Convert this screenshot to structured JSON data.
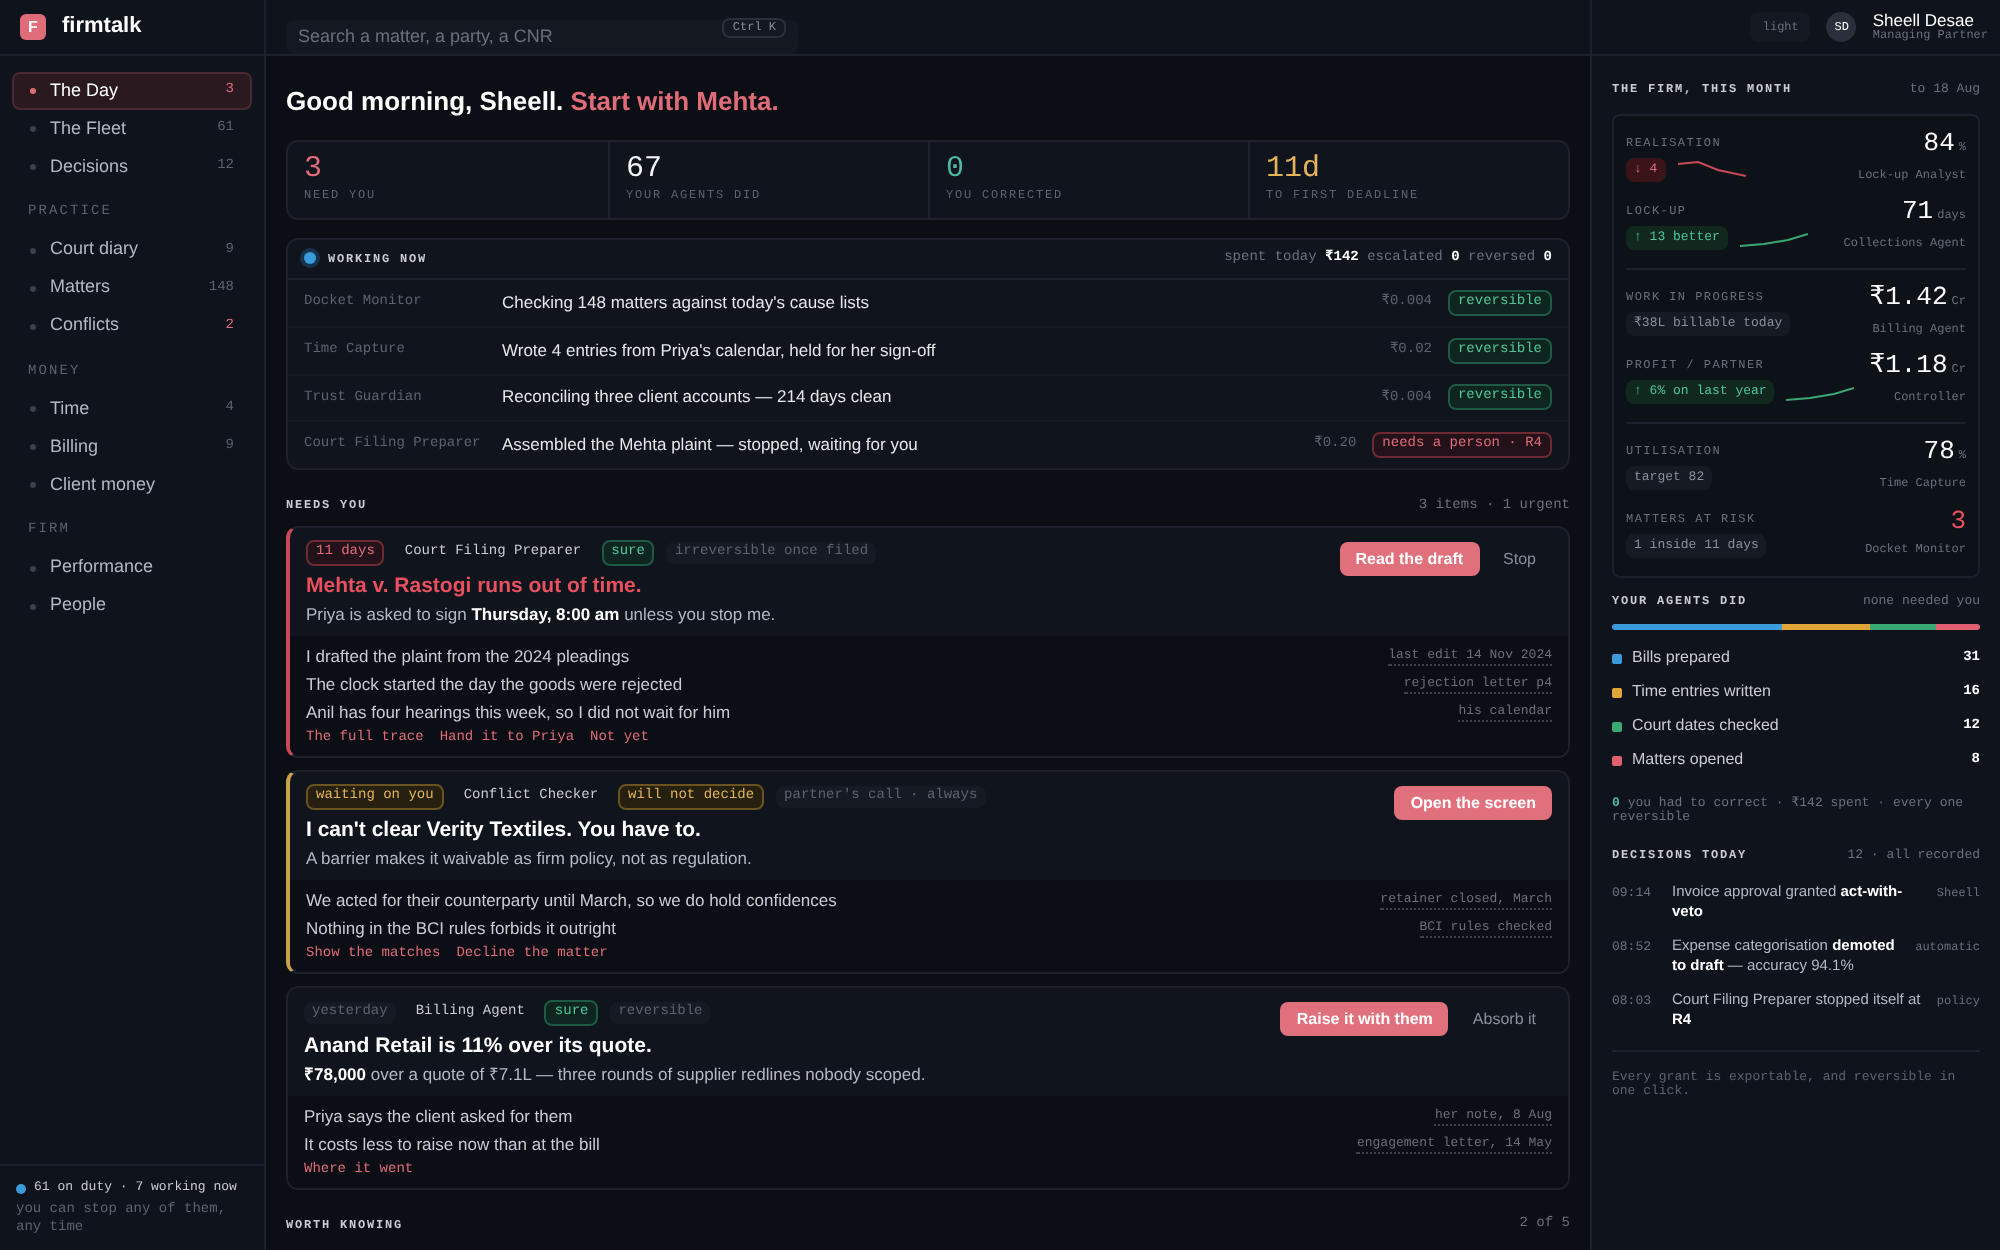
{
  "brand": {
    "letter": "F",
    "name": "firmtalk"
  },
  "sidebar": {
    "sections": [
      {
        "items": [
          {
            "label": "The Day",
            "count": "3",
            "selected": true,
            "alert": true
          },
          {
            "label": "The Fleet",
            "count": "61",
            "selected": false,
            "alert": false
          },
          {
            "label": "Decisions",
            "count": "12",
            "selected": false,
            "alert": false
          }
        ]
      },
      {
        "heading": "PRACTICE",
        "items": [
          {
            "label": "Court diary",
            "count": "9",
            "selected": false,
            "alert": false
          },
          {
            "label": "Matters",
            "count": "148",
            "selected": false,
            "alert": false
          },
          {
            "label": "Conflicts",
            "count": "2",
            "selected": false,
            "alert": true
          }
        ]
      },
      {
        "heading": "MONEY",
        "items": [
          {
            "label": "Time",
            "count": "4",
            "selected": false,
            "alert": false
          },
          {
            "label": "Billing",
            "count": "9",
            "selected": false,
            "alert": false
          },
          {
            "label": "Client money",
            "selected": false
          }
        ]
      },
      {
        "heading": "FIRM",
        "items": [
          {
            "label": "Performance",
            "selected": false
          },
          {
            "label": "People",
            "selected": false
          }
        ]
      }
    ],
    "status": "61 on duty · 7 working now",
    "note": "you can stop any of them, any time"
  },
  "search": {
    "placeholder": "Search a matter, a party, a CNR",
    "shortcut": "Ctrl K"
  },
  "theme_toggle": "light",
  "user": {
    "initials": "SD",
    "name": "Sheell Desae",
    "role": "Managing Partner"
  },
  "greeting": {
    "text": "Good morning, Sheell.",
    "focus": "Start with Mehta."
  },
  "stats": [
    {
      "value": "3",
      "label": "NEED YOU",
      "color": "#e06c7a"
    },
    {
      "value": "67",
      "label": "YOUR AGENTS DID",
      "color": "#f3f4f6"
    },
    {
      "value": "0",
      "label": "YOU CORRECTED",
      "color": "#4fb8a0"
    },
    {
      "value": "11d",
      "label": "TO FIRST DEADLINE",
      "color": "#e5b45a"
    }
  ],
  "working_now": {
    "title": "WORKING NOW",
    "spent_label": "spent today",
    "spent": "₹142",
    "escalated_label": "escalated",
    "escalated": "0",
    "reversed_label": "reversed",
    "reversed": "0",
    "rows": [
      {
        "agent": "Docket Monitor",
        "task": "Checking 148 matters against today's cause lists",
        "cost": "₹0.004",
        "tag": {
          "text": "reversible",
          "kind": "ok"
        }
      },
      {
        "agent": "Time Capture",
        "task": "Wrote 4 entries from Priya's calendar, held for her sign-off",
        "cost": "₹0.02",
        "tag": {
          "text": "reversible",
          "kind": "ok"
        }
      },
      {
        "agent": "Trust Guardian",
        "task": "Reconciling three client accounts — 214 days clean",
        "cost": "₹0.004",
        "tag": {
          "text": "reversible",
          "kind": "ok"
        }
      },
      {
        "agent": "Court Filing Preparer",
        "task": "Assembled the Mehta plaint — stopped, waiting for you",
        "cost": "₹0.20",
        "tag": {
          "text": "needs a person · R4",
          "kind": "alert"
        }
      }
    ]
  },
  "needs_you": {
    "title": "NEEDS YOU",
    "summary": "3 items · 1 urgent",
    "items": [
      {
        "kind": "urgent",
        "tags": [
          {
            "text": "11 days",
            "kind": "alert"
          },
          {
            "text": "Court Filing Preparer",
            "kind": "plain"
          },
          {
            "text": "sure",
            "kind": "ok"
          },
          {
            "text": "irreversible once filed",
            "kind": "muted"
          }
        ],
        "title": "Mehta v. Rastogi runs out of time.",
        "subtitle": "Priya is asked to sign **Thursday, 8:00 am** unless you stop me.",
        "primary": "Read the draft",
        "secondary": "Stop",
        "reasons": [
          {
            "text": "I drafted the plaint from the 2024 pleadings",
            "source": "last edit 14 Nov 2024"
          },
          {
            "text": "The clock started the day the goods were rejected",
            "source": "rejection letter p4"
          },
          {
            "text": "Anil has four hearings this week, so I did not wait for him",
            "source": "his calendar"
          }
        ],
        "links": [
          "The full trace",
          "Hand it to Priya",
          "Not yet"
        ]
      },
      {
        "kind": "blocked",
        "tags": [
          {
            "text": "waiting on you",
            "kind": "warn"
          },
          {
            "text": "Conflict Checker",
            "kind": "plain"
          },
          {
            "text": "will not decide",
            "kind": "warn"
          },
          {
            "text": "partner's call · always",
            "kind": "muted"
          }
        ],
        "title": "I can't clear Verity Textiles. You have to.",
        "subtitle": "A barrier makes it waivable as firm policy, not as regulation.",
        "primary": "Open the screen",
        "reasons": [
          {
            "text": "We acted for their counterparty until March, so we do hold confidences",
            "source": "retainer closed, March"
          },
          {
            "text": "Nothing in the BCI rules forbids it outright",
            "source": "BCI rules checked"
          }
        ],
        "links": [
          "Show the matches",
          "Decline the matter"
        ]
      },
      {
        "kind": "normal",
        "tags": [
          {
            "text": "yesterday",
            "kind": "muted"
          },
          {
            "text": "Billing Agent",
            "kind": "plain"
          },
          {
            "text": "sure",
            "kind": "ok"
          },
          {
            "text": "reversible",
            "kind": "muted"
          }
        ],
        "title": "Anand Retail is 11% over its quote.",
        "subtitle": "**₹78,000** over a quote of ₹7.1L — three rounds of supplier redlines nobody scoped.",
        "primary": "Raise it with them",
        "secondary": "Absorb it",
        "reasons": [
          {
            "text": "Priya says the client asked for them",
            "source": "her note, 8 Aug"
          },
          {
            "text": "It costs less to raise now than at the bill",
            "source": "engagement letter, 14 May"
          }
        ],
        "links": [
          "Where it went"
        ]
      }
    ]
  },
  "worth_knowing": {
    "title": "WORTH KNOWING",
    "count": "2 of 5"
  },
  "firm": {
    "title": "THE FIRM, THIS MONTH",
    "period": "to 18 Aug",
    "groups": [
      [
        {
          "label": "REALISATION",
          "badge": {
            "text": "↓ 4",
            "kind": "down"
          },
          "sparkline": {
            "kind": "down"
          },
          "value": "84",
          "unit": "%",
          "agent": "Lock-up Analyst",
          "alert": false
        },
        {
          "label": "LOCK-UP",
          "badge": {
            "text": "↑ 13 better",
            "kind": "up"
          },
          "sparkline": {
            "kind": "up"
          },
          "value": "71",
          "unit": "days",
          "agent": "Collections Agent",
          "alert": false
        }
      ],
      [
        {
          "label": "WORK IN PROGRESS",
          "badge": {
            "text": "₹38L billable today",
            "kind": "neutral"
          },
          "value": "₹1.42",
          "unit": "Cr",
          "agent": "Billing Agent",
          "alert": false
        },
        {
          "label": "PROFIT / PARTNER",
          "badge": {
            "text": "↑ 6% on last year",
            "kind": "up"
          },
          "sparkline": {
            "kind": "up"
          },
          "value": "₹1.18",
          "unit": "Cr",
          "agent": "Controller",
          "alert": false
        }
      ],
      [
        {
          "label": "UTILISATION",
          "badge": {
            "text": "target 82",
            "kind": "neutral"
          },
          "value": "78",
          "unit": "%",
          "agent": "Time Capture",
          "alert": false
        },
        {
          "label": "MATTERS AT RISK",
          "badge": {
            "text": "1 inside 11 days",
            "kind": "neutral"
          },
          "value": "3",
          "agent": "Docket Monitor",
          "alert": true
        }
      ]
    ]
  },
  "agents_did": {
    "title": "YOUR AGENTS DID",
    "note": "none needed you",
    "items": [
      {
        "label": "Bills prepared",
        "count": "31",
        "color": "#3b9ad9"
      },
      {
        "label": "Time entries written",
        "count": "16",
        "color": "#e0a63a"
      },
      {
        "label": "Court dates checked",
        "count": "12",
        "color": "#3aa872"
      },
      {
        "label": "Matters opened",
        "count": "8",
        "color": "#e0606f"
      }
    ]
  },
  "correction": {
    "count": "0",
    "text": "you had to correct · ₹142 spent · every one reversible"
  },
  "decisions": {
    "title": "DECISIONS TODAY",
    "summary": "12 · all recorded",
    "items": [
      {
        "time": "09:14",
        "text": "Invoice approval granted **act-with-veto**",
        "by": "Sheell"
      },
      {
        "time": "08:52",
        "text": "Expense categorisation **demoted to draft** — accuracy 94.1%",
        "by": "automatic"
      },
      {
        "time": "08:03",
        "text": "Court Filing Preparer stopped itself at **R4**",
        "by": "policy"
      }
    ]
  },
  "footer_note": "Every grant is exportable, and reversible in one click."
}
